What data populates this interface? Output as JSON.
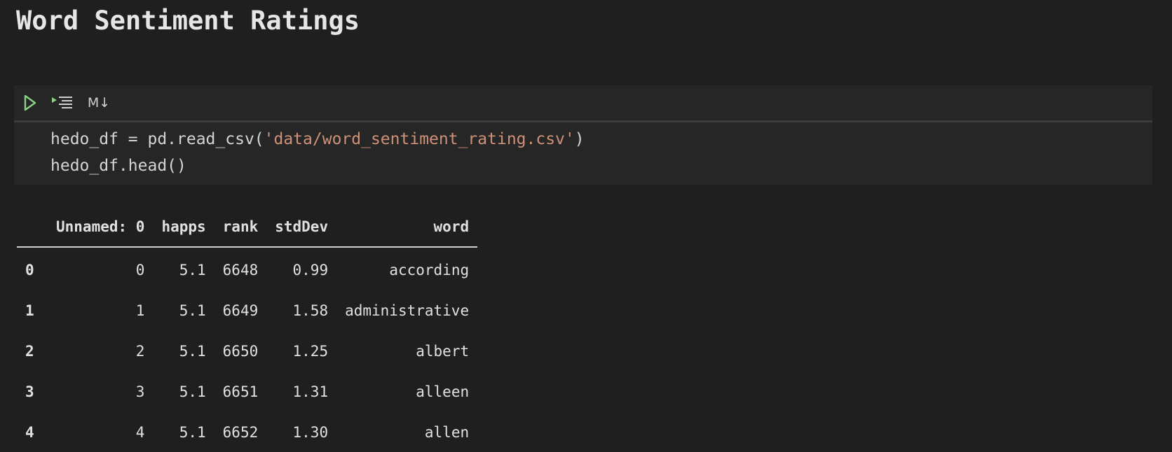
{
  "heading": "Word Sentiment Ratings",
  "toolbar": {
    "run_icon": "play-icon",
    "run_above_icon": "run-above-icon",
    "markdown_label": "M↓"
  },
  "code": {
    "line1_prefix": "hedo_df = pd.read_csv(",
    "line1_string": "'data/word_sentiment_rating.csv'",
    "line1_suffix": ")",
    "line2": "hedo_df.head()"
  },
  "table": {
    "columns": [
      "",
      "Unnamed: 0",
      "happs",
      "rank",
      "stdDev",
      "word"
    ],
    "rows": [
      [
        "0",
        "0",
        "5.1",
        "6648",
        "0.99",
        "according"
      ],
      [
        "1",
        "1",
        "5.1",
        "6649",
        "1.58",
        "administrative"
      ],
      [
        "2",
        "2",
        "5.1",
        "6650",
        "1.25",
        "albert"
      ],
      [
        "3",
        "3",
        "5.1",
        "6651",
        "1.31",
        "alleen"
      ],
      [
        "4",
        "4",
        "5.1",
        "6652",
        "1.30",
        "allen"
      ]
    ]
  },
  "colors": {
    "background": "#1f1f1f",
    "cell_background": "#262626",
    "run_green": "#89d185",
    "string": "#ce9178"
  }
}
